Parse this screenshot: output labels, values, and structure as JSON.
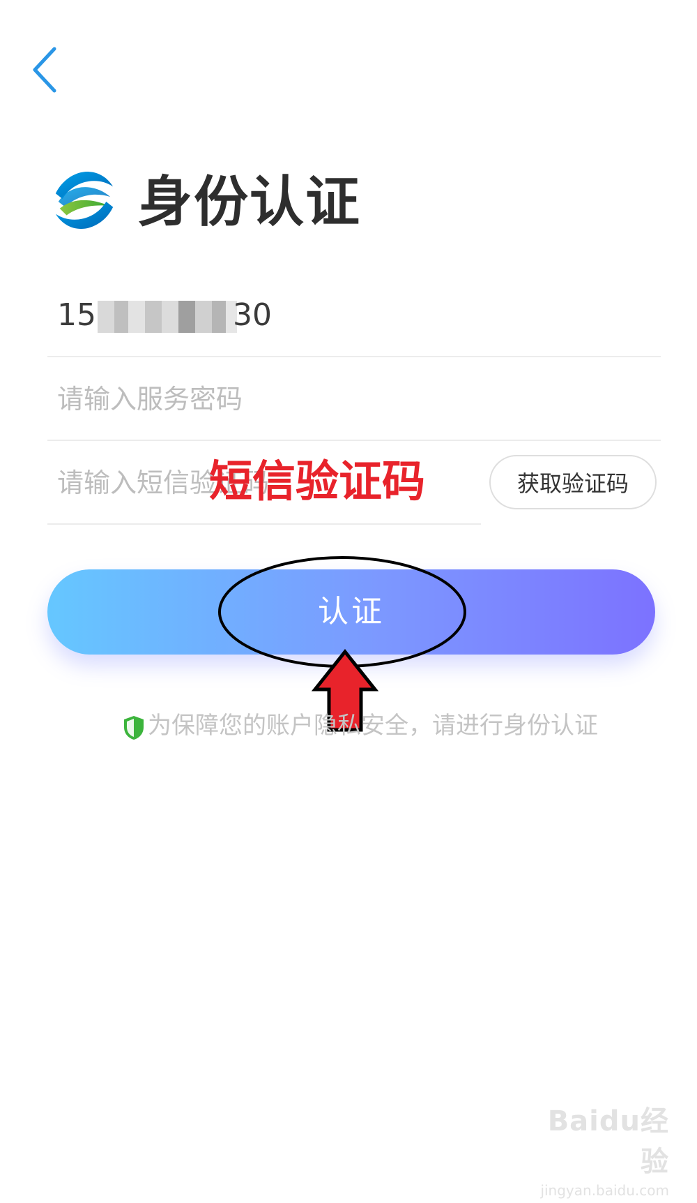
{
  "header": {
    "back_icon": "chevron-left-icon",
    "logo_icon": "china-mobile-logo-icon",
    "title": "身份认证"
  },
  "form": {
    "phone": {
      "prefix": "15",
      "suffix": "30"
    },
    "password": {
      "placeholder": "请输入服务密码"
    },
    "sms": {
      "placeholder": "请输入短信验证码",
      "get_code_label": "获取验证码"
    },
    "submit_label": "认证"
  },
  "annotation": {
    "label": "短信验证码",
    "color": "#e8232b"
  },
  "notice": {
    "icon": "shield-check-icon",
    "text": "为保障您的账户隐私安全，请进行身份认证"
  },
  "watermark": {
    "logo_text": "Baidu经验",
    "sub_text": "jingyan.baidu.com"
  },
  "colors": {
    "accent_blue": "#2196f3",
    "gradient_start": "#65c7ff",
    "gradient_end": "#7c72ff",
    "shield_green": "#3cb43c"
  }
}
